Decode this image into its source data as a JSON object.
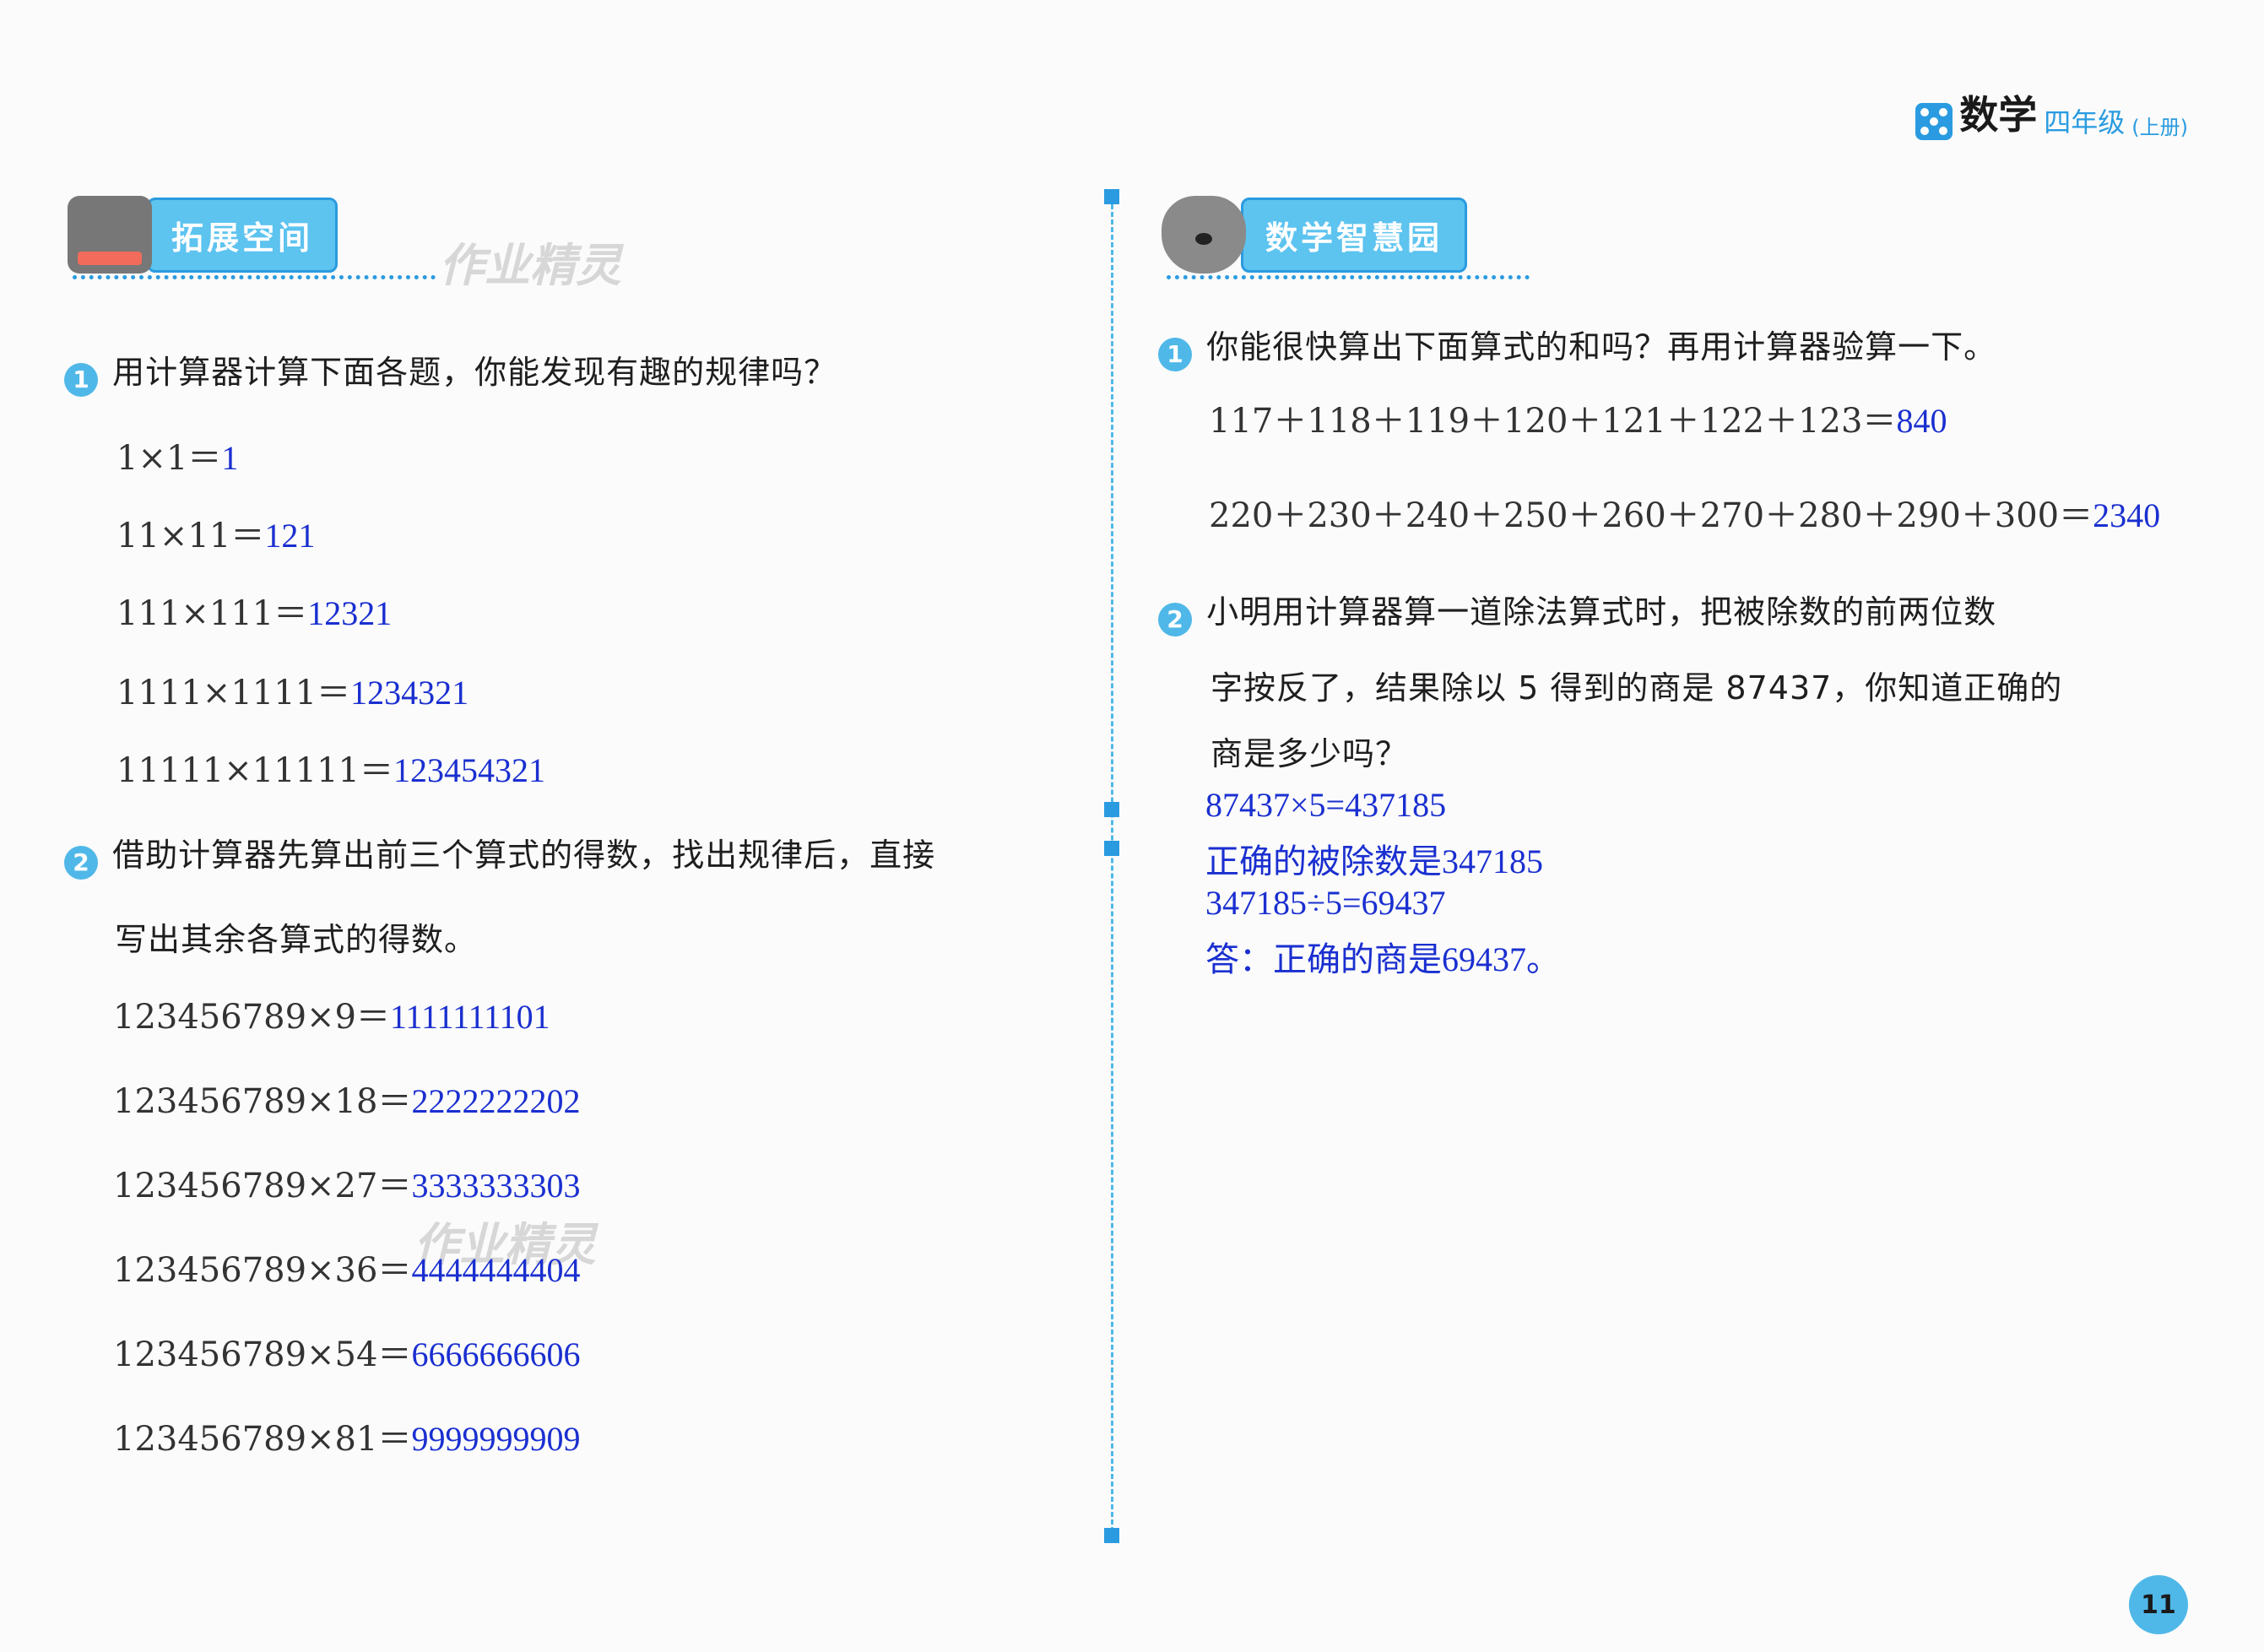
{
  "header": {
    "brand": "数学",
    "grade": "四年级",
    "term": "(上册)"
  },
  "left": {
    "section_title": "拓展空间",
    "watermark": "作业精灵",
    "q1": {
      "num": "1",
      "text": "用计算器计算下面各题，你能发现有趣的规律吗？",
      "items": [
        {
          "expr": "1×1＝",
          "ans": "1"
        },
        {
          "expr": "11×11＝",
          "ans": "121"
        },
        {
          "expr": "111×111＝",
          "ans": "12321"
        },
        {
          "expr": "1111×1111＝",
          "ans": "1234321"
        },
        {
          "expr": "11111×11111＝",
          "ans": "123454321"
        }
      ]
    },
    "q2": {
      "num": "2",
      "text1": "借助计算器先算出前三个算式的得数，找出规律后，直接",
      "text2": "写出其余各算式的得数。",
      "items": [
        {
          "expr": "123456789×9＝",
          "ans": "1111111101"
        },
        {
          "expr": "123456789×18＝",
          "ans": "2222222202"
        },
        {
          "expr": "123456789×27＝",
          "ans": "3333333303"
        },
        {
          "expr": "123456789×36＝",
          "ans": "4444444404"
        },
        {
          "expr": "123456789×54＝",
          "ans": "6666666606"
        },
        {
          "expr": "123456789×81＝",
          "ans": "9999999909"
        }
      ]
    }
  },
  "right": {
    "section_title": "数学智慧园",
    "q1": {
      "num": "1",
      "text": "你能很快算出下面算式的和吗？再用计算器验算一下。",
      "items": [
        {
          "expr": "117＋118＋119＋120＋121＋122＋123＝",
          "ans": "840"
        },
        {
          "expr": "220＋230＋240＋250＋260＋270＋280＋290＋300＝",
          "ans": "2340"
        }
      ]
    },
    "q2": {
      "num": "2",
      "text1": "小明用计算器算一道除法算式时，把被除数的前两位数",
      "text2": "字按反了，结果除以 5 得到的商是 87437，你知道正确的",
      "text3": "商是多少吗？",
      "work": [
        "87437×5=437185",
        "正确的被除数是347185",
        "347185÷5=69437",
        "答：正确的商是69437。"
      ]
    }
  },
  "page_number": "11"
}
